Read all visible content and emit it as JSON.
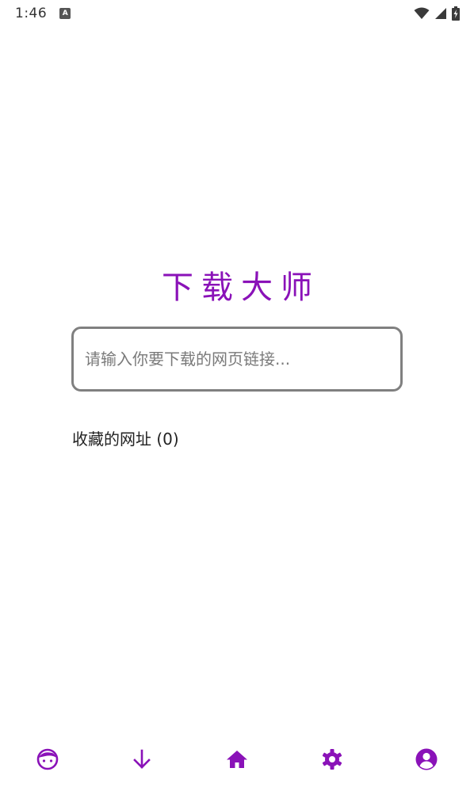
{
  "status_bar": {
    "time": "1:46",
    "app_icon_letter": "A",
    "icons": [
      "wifi-icon",
      "cell-signal-icon",
      "battery-charging-icon"
    ]
  },
  "app": {
    "title": "下载大师",
    "accent_color": "#8a12b8"
  },
  "url_input": {
    "placeholder": "请输入你要下载的网页链接...",
    "value": ""
  },
  "favorites": {
    "label": "收藏的网址 (0)"
  },
  "bottom_nav": {
    "items": [
      {
        "icon": "face-icon"
      },
      {
        "icon": "arrow-down-icon"
      },
      {
        "icon": "home-icon"
      },
      {
        "icon": "gear-icon"
      },
      {
        "icon": "account-circle-icon"
      }
    ]
  }
}
